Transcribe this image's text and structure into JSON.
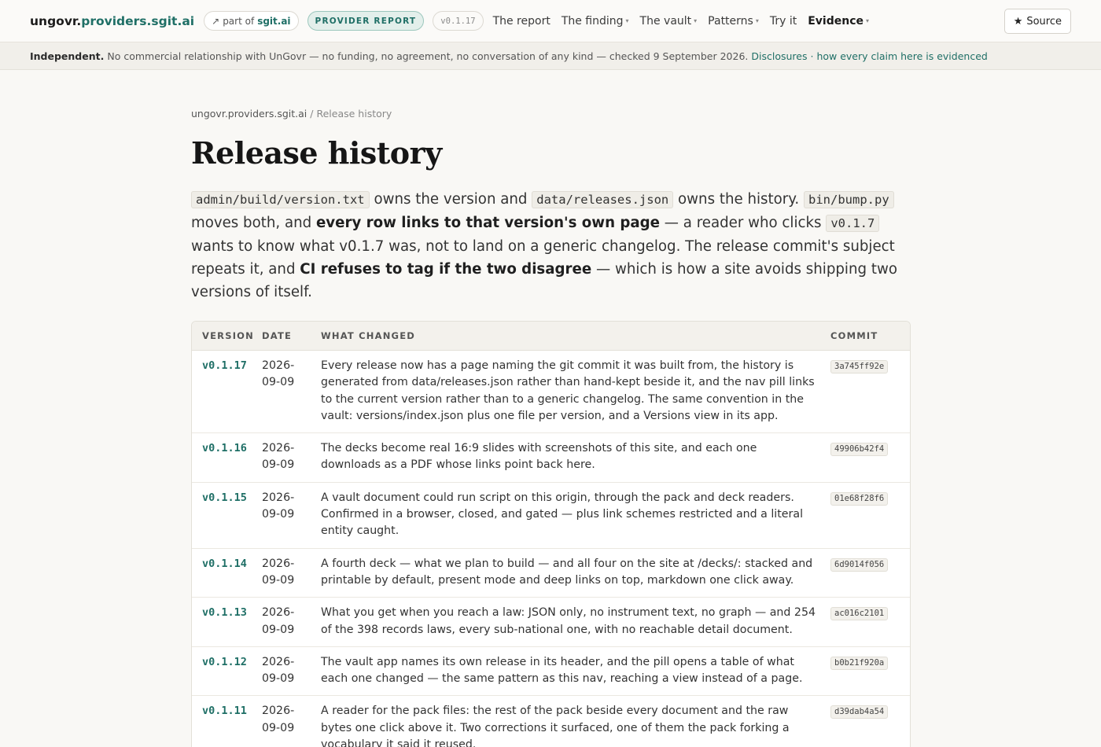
{
  "brand": {
    "prefix": "ungovr.",
    "suffix": "providers.sgit.ai"
  },
  "part_of": {
    "arrow": "↗",
    "label": "part of",
    "site": "sgit.ai"
  },
  "report_pill": "PROVIDER REPORT",
  "version_pill": "v0.1.17",
  "nav": [
    {
      "label": "The report",
      "dropdown": false
    },
    {
      "label": "The finding",
      "dropdown": true
    },
    {
      "label": "The vault",
      "dropdown": true
    },
    {
      "label": "Patterns",
      "dropdown": true
    },
    {
      "label": "Try it",
      "dropdown": false
    },
    {
      "label": "Evidence",
      "dropdown": true
    }
  ],
  "source_button": {
    "icon": "★",
    "label": "Source"
  },
  "notice": {
    "lead": "Independent.",
    "text": "No commercial relationship with UnGovr — no funding, no agreement, no conversation of any kind — checked 9 September 2026.",
    "link1": "Disclosures",
    "sep": "·",
    "link2": "how every claim here is evidenced"
  },
  "breadcrumb": {
    "home": "ungovr.providers.sgit.ai",
    "sep": "/",
    "current": "Release history"
  },
  "title": "Release history",
  "lede": {
    "code1": "admin/build/version.txt",
    "t1": "owns the version and",
    "code2": "data/releases.json",
    "t2": "owns the history.",
    "code3": "bin/bump.py",
    "t3": "moves both, and",
    "b1": "every row links to that version's own page",
    "t4": "— a reader who clicks",
    "code4": "v0.1.7",
    "t5": "wants to know what v0.1.7 was, not to land on a generic changelog. The release commit's subject repeats it, and",
    "b2": "CI refuses to tag if the two disagree",
    "t6": "— which is how a site avoids shipping two versions of itself."
  },
  "table": {
    "headers": {
      "version": "VERSION",
      "date": "DATE",
      "what": "WHAT CHANGED",
      "commit": "COMMIT"
    },
    "rows": [
      {
        "version": "v0.1.17",
        "date": "2026-09-09",
        "what": "Every release now has a page naming the git commit it was built from, the history is generated from data/releases.json rather than hand-kept beside it, and the nav pill links to the current version rather than to a generic changelog. The same convention in the vault: versions/index.json plus one file per version, and a Versions view in its app.",
        "commit": "3a745ff92e"
      },
      {
        "version": "v0.1.16",
        "date": "2026-09-09",
        "what": "The decks become real 16:9 slides with screenshots of this site, and each one downloads as a PDF whose links point back here.",
        "commit": "49906b42f4"
      },
      {
        "version": "v0.1.15",
        "date": "2026-09-09",
        "what": "A vault document could run script on this origin, through the pack and deck readers. Confirmed in a browser, closed, and gated — plus link schemes restricted and a literal entity caught.",
        "commit": "01e68f28f6"
      },
      {
        "version": "v0.1.14",
        "date": "2026-09-09",
        "what": "A fourth deck — what we plan to build — and all four on the site at /decks/: stacked and printable by default, present mode and deep links on top, markdown one click away.",
        "commit": "6d9014f056"
      },
      {
        "version": "v0.1.13",
        "date": "2026-09-09",
        "what": "What you get when you reach a law: JSON only, no instrument text, no graph — and 254 of the 398 records laws, every sub-national one, with no reachable detail document.",
        "commit": "ac016c2101"
      },
      {
        "version": "v0.1.12",
        "date": "2026-09-09",
        "what": "The vault app names its own release in its header, and the pill opens a table of what each one changed — the same pattern as this nav, reaching a view instead of a page.",
        "commit": "b0b21f920a"
      },
      {
        "version": "v0.1.11",
        "date": "2026-09-09",
        "what": "A reader for the pack files: the rest of the pack beside every document and the raw bytes one click above it. Two corrections it surfaced, one of them the pack forking a vocabulary it said it reused.",
        "commit": "d39dab4a54"
      }
    ]
  }
}
